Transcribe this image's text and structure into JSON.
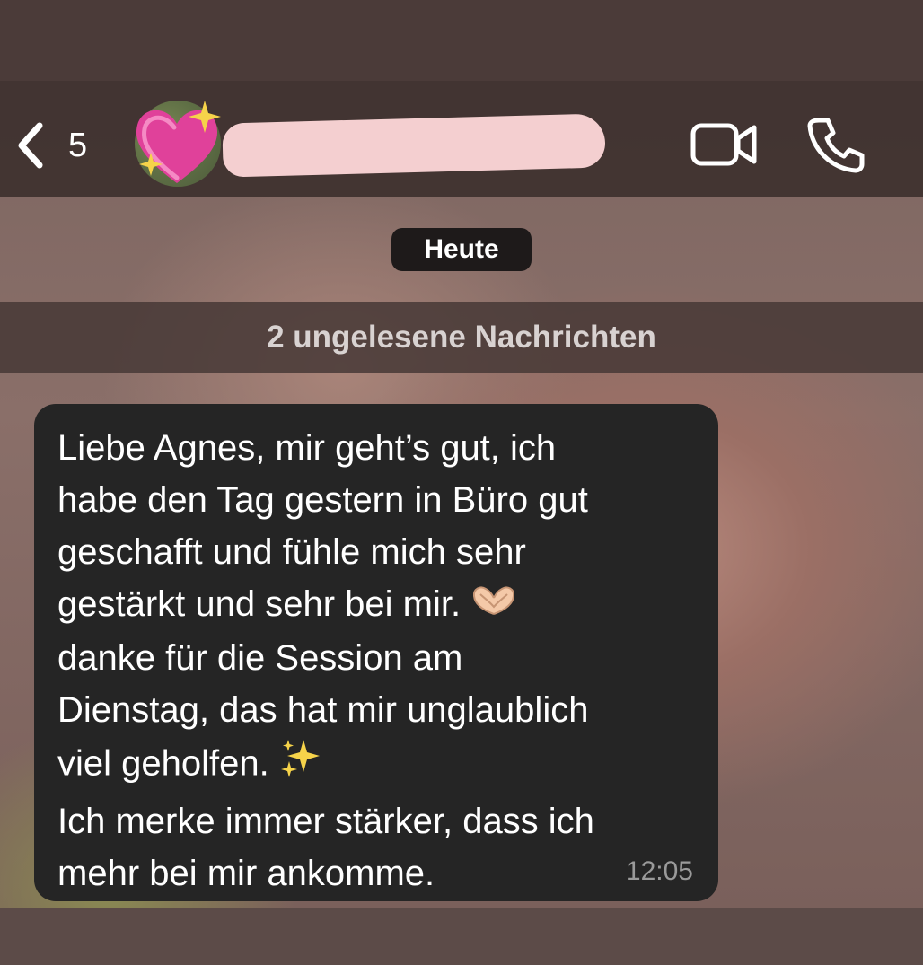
{
  "header": {
    "back_count": "5",
    "contact_name_redacted": true,
    "icons": [
      "chevron-left-icon",
      "video-camera-icon",
      "phone-icon"
    ]
  },
  "chat": {
    "day_label": "Heute",
    "unread_banner": "2 ungelesene Nachrichten",
    "messages": [
      {
        "lines": [
          "Liebe Agnes, mir geht’s gut, ich",
          "habe den Tag gestern in Büro gut",
          "geschafft und fühle mich sehr",
          "gestärkt und sehr bei mir.",
          "danke für die Session am",
          "Dienstag, das hat mir unglaublich",
          "viel geholfen.",
          "Ich merke immer stärker, dass ich",
          "mehr bei mir ankomme."
        ],
        "emojis": [
          "heart-hands-emoji",
          "sparkles-emoji"
        ],
        "time": "12:05"
      }
    ]
  },
  "colors": {
    "bubble": "#252525",
    "header": "#3a2d2b",
    "redaction": "#f4cfd0",
    "timestamp": "#9a9a9a"
  }
}
